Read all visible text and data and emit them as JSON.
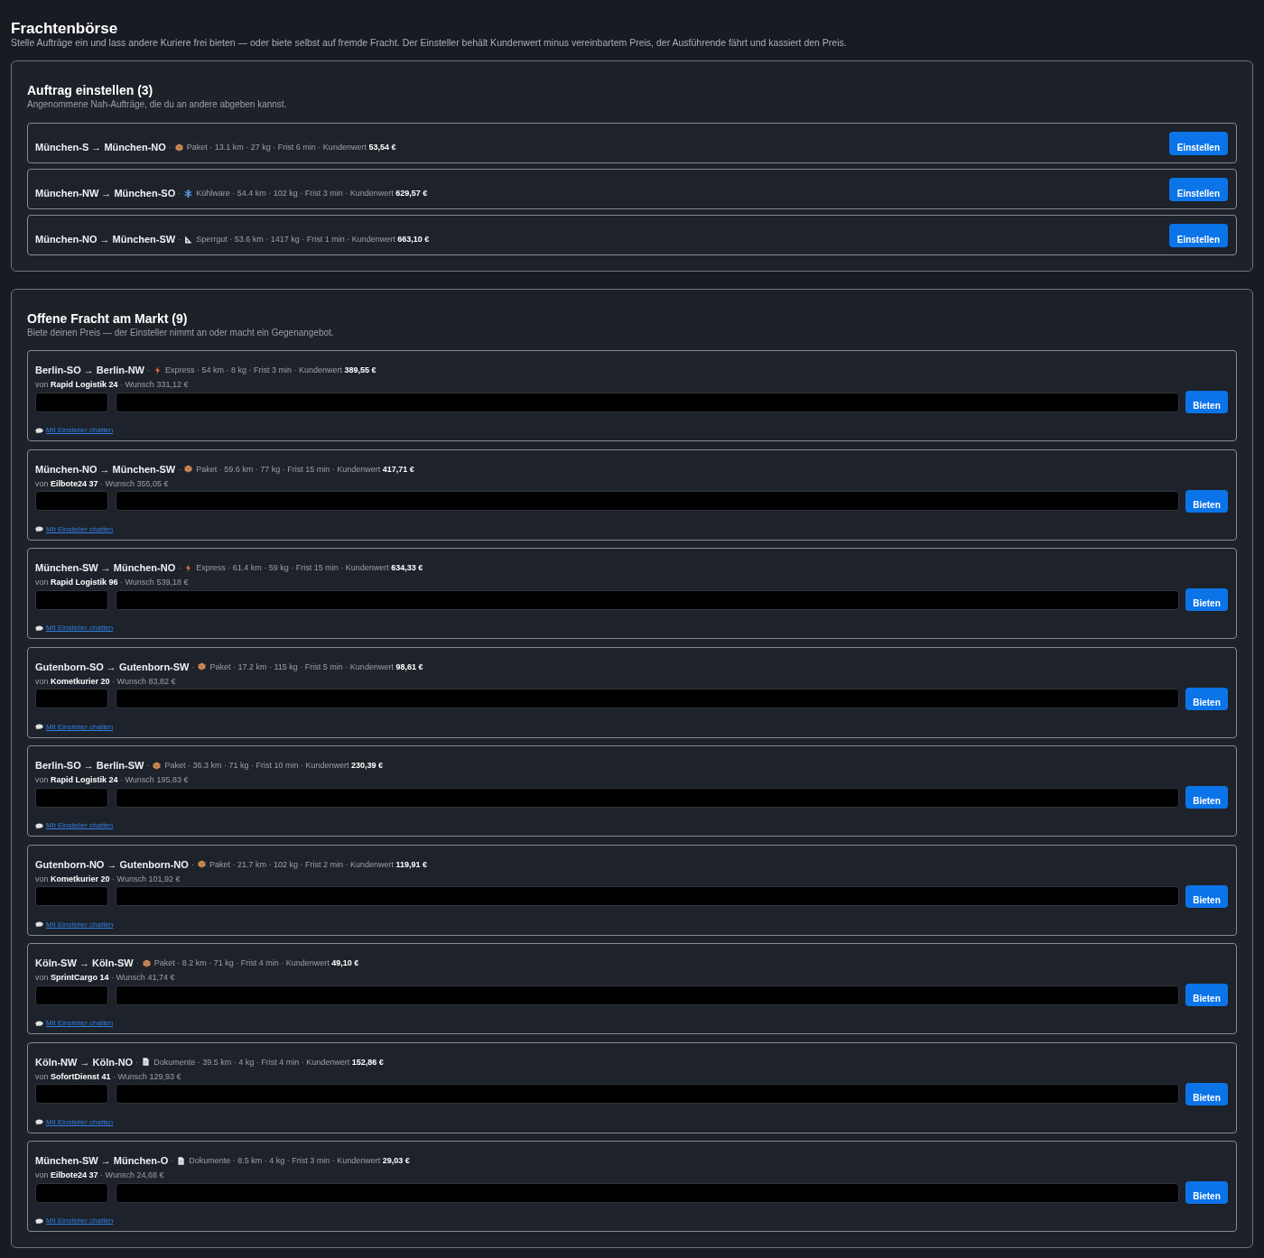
{
  "header": {
    "title": "Frachtenbörse",
    "subtitle": "Stelle Aufträge ein und lass andere Kuriere frei bieten — oder biete selbst auf fremde Fracht. Der Einsteller behält Kundenwert minus vereinbartem Preis, der Ausführende fährt und kassiert den Preis."
  },
  "post_section": {
    "title": "Auftrag einstellen (3)",
    "subtitle": "Angenommene Nah-Aufträge, die du an andere abgeben kannst.",
    "orders": [
      {
        "route": "München-S → München-NO",
        "separator": "·",
        "kind": "package",
        "details": "Paket · 13.1 km · 27 kg · Frist 6 min · Kundenwert **53,54 €**",
        "button": "Einstellen"
      },
      {
        "route": "München-NW → München-SO",
        "separator": "·",
        "kind": "cold",
        "details": "Kühlware · 54.4 km · 102 kg · Frist 3 min · Kundenwert **629,57 €**",
        "button": "Einstellen"
      },
      {
        "route": "München-NO → München-SW",
        "separator": "·",
        "kind": "bulky",
        "details": "Sperrgut · 53.6 km · 1417 kg · Frist 1 min · Kundenwert **663,10 €**",
        "button": "Einstellen"
      }
    ]
  },
  "market_section": {
    "title": "Offene Fracht am Markt (9)",
    "subtitle": "Biete deinen Preis — der Einsteller nimmt an oder macht ein Gegenangebot.",
    "offers": [
      {
        "route": "Berlin-SO → Berlin-NW",
        "separator": "·",
        "kind": "express",
        "details": "Express · 54 km · 8 kg · Frist 3 min · Kundenwert **389,55 €**",
        "seller": "von **Rapid Logistik 24** · Wunsch 331,12 €",
        "button": "Bieten",
        "chat_link": "Mit Einsteller chatten"
      },
      {
        "route": "München-NO → München-SW",
        "separator": "·",
        "kind": "package",
        "details": "Paket · 59.6 km · 77 kg · Frist 15 min · Kundenwert **417,71 €**",
        "seller": "von **Eilbote24 37** · Wunsch 355,05 €",
        "button": "Bieten",
        "chat_link": "Mit Einsteller chatten"
      },
      {
        "route": "München-SW → München-NO",
        "separator": "·",
        "kind": "express",
        "details": "Express · 61.4 km · 59 kg · Frist 15 min · Kundenwert **634,33 €**",
        "seller": "von **Rapid Logistik 96** · Wunsch 539,18 €",
        "button": "Bieten",
        "chat_link": "Mit Einsteller chatten"
      },
      {
        "route": "Gutenborn-SO → Gutenborn-SW",
        "separator": "·",
        "kind": "package",
        "details": "Paket · 17.2 km · 115 kg · Frist 5 min · Kundenwert **98,61 €**",
        "seller": "von **Kometkurier 20** · Wunsch 83,82 €",
        "button": "Bieten",
        "chat_link": "Mit Einsteller chatten"
      },
      {
        "route": "Berlin-SO → Berlin-SW",
        "separator": "·",
        "kind": "package",
        "details": "Paket · 36.3 km · 71 kg · Frist 10 min · Kundenwert **230,39 €**",
        "seller": "von **Rapid Logistik 24** · Wunsch 195,83 €",
        "button": "Bieten",
        "chat_link": "Mit Einsteller chatten"
      },
      {
        "route": "Gutenborn-NO → Gutenborn-NO",
        "separator": "·",
        "kind": "package",
        "details": "Paket · 21.7 km · 102 kg · Frist 2 min · Kundenwert **119,91 €**",
        "seller": "von **Kometkurier 20** · Wunsch 101,92 €",
        "button": "Bieten",
        "chat_link": "Mit Einsteller chatten"
      },
      {
        "route": "Köln-SW → Köln-SW",
        "separator": "·",
        "kind": "package",
        "details": "Paket · 8.2 km · 71 kg · Frist 4 min · Kundenwert **49,10 €**",
        "seller": "von **SprintCargo 14** · Wunsch 41,74 €",
        "button": "Bieten",
        "chat_link": "Mit Einsteller chatten"
      },
      {
        "route": "Köln-NW → Köln-NO",
        "separator": "·",
        "kind": "document",
        "details": "Dokumente · 39.5 km · 4 kg · Frist 4 min · Kundenwert **152,86 €**",
        "seller": "von **SofortDienst 41** · Wunsch 129,93 €",
        "button": "Bieten",
        "chat_link": "Mit Einsteller chatten"
      },
      {
        "route": "München-SW → München-O",
        "separator": "·",
        "kind": "document",
        "details": "Dokumente · 8.5 km · 4 kg · Frist 3 min · Kundenwert **29,03 €**",
        "seller": "von **Eilbote24 37** · Wunsch 24,68 €",
        "button": "Bieten",
        "chat_link": "Mit Einsteller chatten"
      }
    ]
  }
}
